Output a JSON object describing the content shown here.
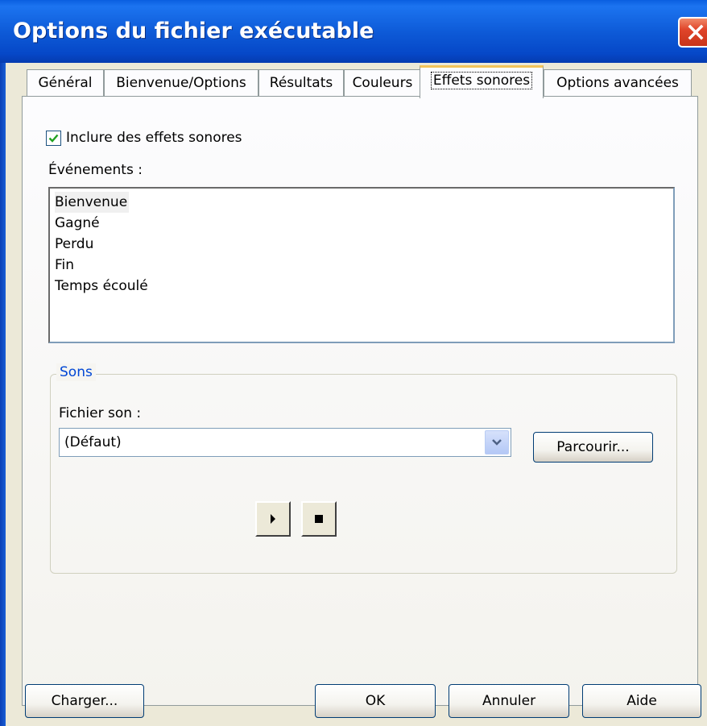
{
  "window": {
    "title": "Options du fichier exécutable"
  },
  "tabs": [
    {
      "label": "Général"
    },
    {
      "label": "Bienvenue/Options"
    },
    {
      "label": "Résultats"
    },
    {
      "label": "Couleurs"
    },
    {
      "label": "Effets sonores",
      "active": true
    },
    {
      "label": "Options avancées"
    }
  ],
  "sound_effects": {
    "include_checkbox": {
      "label": "Inclure des effets sonores",
      "checked": true
    },
    "events_label": "Événements :",
    "events": [
      "Bienvenue",
      "Gagné",
      "Perdu",
      "Fin",
      "Temps écoulé"
    ],
    "selected_event": "Bienvenue",
    "group_title": "Sons",
    "file_label": "Fichier son :",
    "file_value": "(Défaut)",
    "browse_label": "Parcourir...",
    "play_icon": "play-icon",
    "stop_icon": "stop-icon"
  },
  "footer": {
    "load_label": "Charger...",
    "ok_label": "OK",
    "cancel_label": "Annuler",
    "help_label": "Aide"
  },
  "colors": {
    "titlebar": "#0A5FE0",
    "close_button": "#E0452A",
    "dialog_bg": "#ECE9D8",
    "group_title": "#0046D5",
    "active_tab_accent": "#F3C45A"
  }
}
